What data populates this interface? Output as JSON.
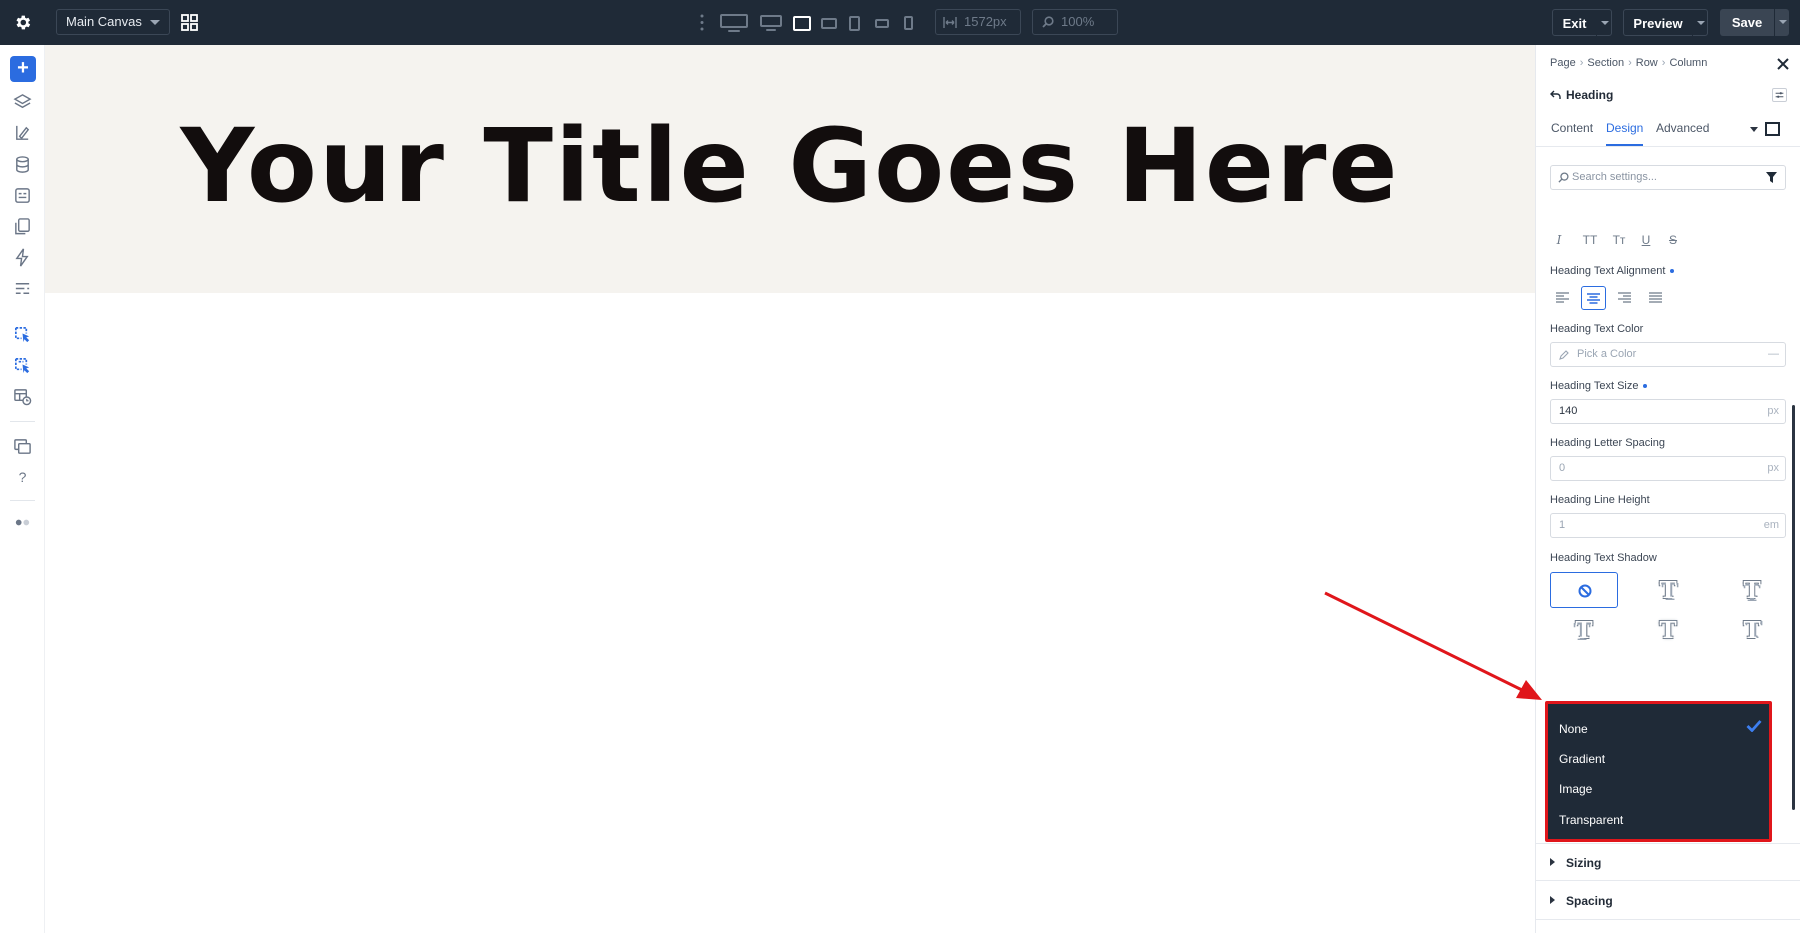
{
  "topbar": {
    "canvas_name": "Main Canvas",
    "width_value": "1572px",
    "zoom_value": "100%",
    "exit_label": "Exit",
    "preview_label": "Preview",
    "save_label": "Save",
    "icons": [
      "gear-icon",
      "grid-icon",
      "more-icon",
      "desktop-xl-icon",
      "desktop-icon",
      "laptop-icon",
      "tablet-landscape-icon",
      "tablet-icon",
      "phone-landscape-icon",
      "phone-icon",
      "width-icon",
      "zoom-icon"
    ]
  },
  "sidebar": {
    "add_label": "+",
    "icons": [
      "layers-icon",
      "brush-icon",
      "database-icon",
      "forms-icon",
      "pages-icon",
      "lightning-icon",
      "settings-lines-icon",
      "element-pointer-icon",
      "element-pointer-alt-icon",
      "template-clock-icon",
      "windows-icon",
      "help-icon",
      "dots-icon"
    ],
    "help_label": "?"
  },
  "canvas": {
    "heading_text": "Your Title Goes Here",
    "hero_bg": "#f5f3ef"
  },
  "panel": {
    "breadcrumbs": [
      "Page",
      "Section",
      "Row",
      "Column"
    ],
    "module_title": "Heading",
    "tabs": [
      {
        "label": "Content",
        "active": false
      },
      {
        "label": "Design",
        "active": true
      },
      {
        "label": "Advanced",
        "active": false
      }
    ],
    "search_placeholder": "Search settings...",
    "text_style_icons": [
      "I",
      "TT",
      "Tт",
      "U",
      "S"
    ],
    "alignment": {
      "label": "Heading Text Alignment",
      "options": [
        "left",
        "center",
        "right",
        "justify"
      ],
      "selected": "center"
    },
    "text_color": {
      "label": "Heading Text Color",
      "placeholder": "Pick a Color",
      "clear_symbol": "—"
    },
    "text_size": {
      "label": "Heading Text Size",
      "value": "140",
      "unit": "px"
    },
    "letter_spacing": {
      "label": "Heading Letter Spacing",
      "value": "0",
      "unit": "px"
    },
    "line_height": {
      "label": "Heading Line Height",
      "value": "1",
      "unit": "em"
    },
    "text_shadow": {
      "label": "Heading Text Shadow",
      "selected": "none",
      "preset_glyph": "T"
    },
    "clip_dropdown": {
      "options": [
        "None",
        "Gradient",
        "Image",
        "Transparent"
      ],
      "selected": "None"
    },
    "sections": [
      "Sizing",
      "Spacing"
    ]
  },
  "colors": {
    "accent": "#2b6ce0",
    "topbar_bg": "#1f2a37",
    "highlight_red": "#e0161b"
  }
}
